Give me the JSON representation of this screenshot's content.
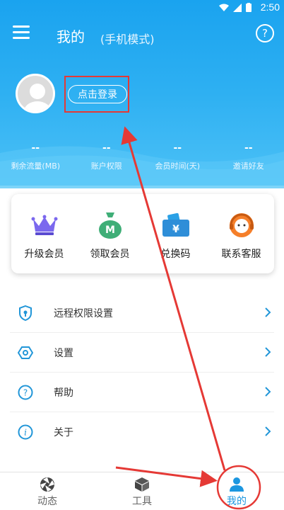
{
  "status": {
    "time": "2:50"
  },
  "header": {
    "title": "我的",
    "subtitle": "(手机模式)",
    "help": "?"
  },
  "profile": {
    "login_label": "点击登录"
  },
  "stats": [
    {
      "value": "--",
      "label": "剩余流量(MB)"
    },
    {
      "value": "--",
      "label": "账户权限"
    },
    {
      "value": "--",
      "label": "会员时间(天)"
    },
    {
      "value": "--",
      "label": "邀请好友"
    }
  ],
  "quick_actions": [
    {
      "label": "升级会员",
      "icon": "crown-icon"
    },
    {
      "label": "领取会员",
      "icon": "money-bag-icon"
    },
    {
      "label": "兑换码",
      "icon": "ticket-icon"
    },
    {
      "label": "联系客服",
      "icon": "support-agent-icon"
    }
  ],
  "menu": [
    {
      "label": "远程权限设置",
      "icon": "shield-icon"
    },
    {
      "label": "设置",
      "icon": "settings-icon"
    },
    {
      "label": "帮助",
      "icon": "help-icon"
    },
    {
      "label": "关于",
      "icon": "info-icon"
    }
  ],
  "bottom_nav": [
    {
      "label": "动态",
      "icon": "aperture-icon"
    },
    {
      "label": "工具",
      "icon": "box-icon"
    },
    {
      "label": "我的",
      "icon": "person-icon",
      "active": true
    }
  ],
  "colors": {
    "primary": "#1aa3ef",
    "annotation": "#e53935",
    "active": "#1c97e0"
  }
}
